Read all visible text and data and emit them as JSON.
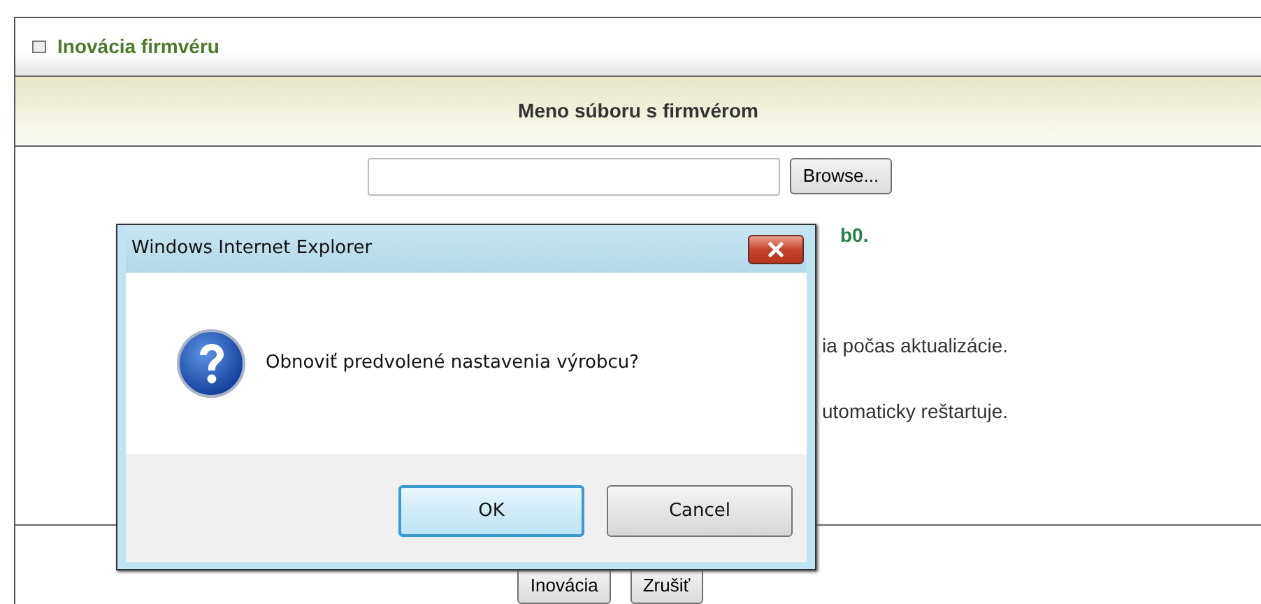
{
  "panel": {
    "title": "Inovácia firmvéru"
  },
  "section": {
    "heading": "Meno súboru s firmvérom"
  },
  "browse_button": "Browse...",
  "partial_lines": [
    {
      "text": "b0.",
      "kind": "link"
    },
    {
      "text": "ia počas aktualizácie.",
      "kind": "plain"
    },
    {
      "text": "utomaticky reštartuje.",
      "kind": "plain"
    }
  ],
  "actions": [
    "Inovácia",
    "Zrušiť"
  ],
  "dialog": {
    "title": "Windows Internet Explorer",
    "message": "Obnoviť predvolené nastavenia výrobcu?",
    "buttons": [
      {
        "label": "OK",
        "selected": true
      },
      {
        "label": "Cancel",
        "selected": false
      }
    ]
  }
}
